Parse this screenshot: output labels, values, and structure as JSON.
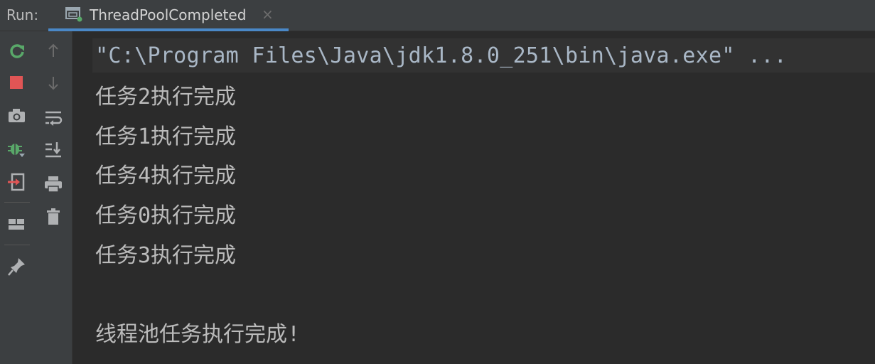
{
  "header": {
    "run_label": "Run:",
    "tab": {
      "title": "ThreadPoolCompleted",
      "close": "×",
      "icon": "console-app-icon"
    }
  },
  "toolbar": {
    "left_icons": [
      "rerun-icon",
      "stop-icon",
      "camera-icon",
      "debug-bug-icon",
      "exit-icon",
      "layout-icon",
      "pin-icon"
    ],
    "right_icons": [
      "arrow-up-icon",
      "arrow-down-icon",
      "soft-wrap-icon",
      "scroll-to-end-icon",
      "print-icon",
      "trash-icon"
    ]
  },
  "console": {
    "command": "\"C:\\Program Files\\Java\\jdk1.8.0_251\\bin\\java.exe\" ...",
    "lines": [
      "任务2执行完成",
      "任务1执行完成",
      "任务4执行完成",
      "任务0执行完成",
      "任务3执行完成",
      "",
      "线程池任务执行完成!"
    ]
  },
  "colors": {
    "background": "#2b2b2b",
    "toolbar": "#3c3f41",
    "tab_underline": "#4a88c7",
    "rerun": "#59a869",
    "stop": "#e05555",
    "text": "#bbbbbb"
  }
}
